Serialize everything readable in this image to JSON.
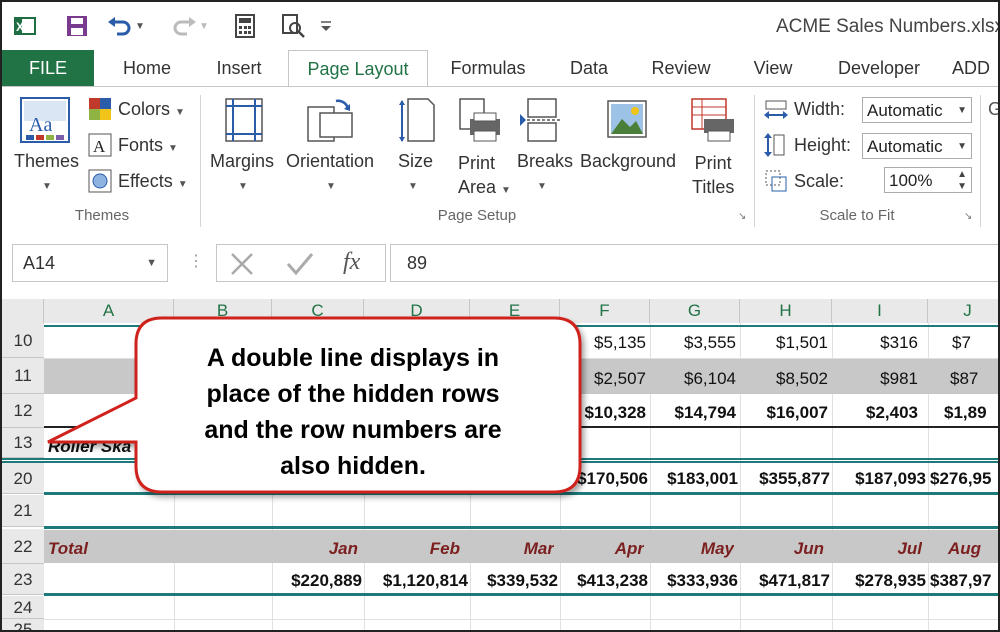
{
  "window": {
    "title": "ACME Sales Numbers.xlsx"
  },
  "qat": {
    "icons": [
      "excel-logo-icon",
      "save-icon",
      "undo-icon",
      "redo-icon",
      "calculator-icon",
      "print-preview-icon",
      "customize-icon"
    ]
  },
  "tabs": [
    "FILE",
    "Home",
    "Insert",
    "Page Layout",
    "Formulas",
    "Data",
    "Review",
    "View",
    "Developer",
    "ADD"
  ],
  "ribbon": {
    "themes_group": {
      "themes": "Themes",
      "colors": "Colors",
      "fonts": "Fonts",
      "effects": "Effects",
      "label": "Themes"
    },
    "page_setup": {
      "margins": "Margins",
      "orientation": "Orientation",
      "size": "Size",
      "print_area_1": "Print",
      "print_area_2": "Area",
      "breaks": "Breaks",
      "background": "Background",
      "print_titles_1": "Print",
      "print_titles_2": "Titles",
      "label": "Page Setup"
    },
    "scale_to_fit": {
      "width_label": "Width:",
      "width_value": "Automatic",
      "height_label": "Height:",
      "height_value": "Automatic",
      "scale_label": "Scale:",
      "scale_value": "100%",
      "label": "Scale to Fit"
    },
    "partial": "G"
  },
  "formula_bar": {
    "name_box": "A14",
    "value": "89",
    "fx": "fx"
  },
  "columns": [
    "A",
    "B",
    "C",
    "D",
    "E",
    "F",
    "G",
    "H",
    "I",
    "J"
  ],
  "rows": [
    {
      "num": "10",
      "cells": {
        "A": "",
        "F": "$5,135",
        "G": "$3,555",
        "H": "$1,501",
        "I": "$316",
        "J": "$7"
      }
    },
    {
      "num": "11",
      "cells": {
        "A": "$",
        "F": "$2,507",
        "G": "$6,104",
        "H": "$8,502",
        "I": "$981",
        "J": "$87"
      }
    },
    {
      "num": "12",
      "cells": {
        "F": "$10,328",
        "G": "$14,794",
        "H": "$16,007",
        "I": "$2,403",
        "J": "$1,89"
      }
    },
    {
      "num": "13",
      "cells": {
        "A": "Roller Ska"
      }
    },
    {
      "num": "20",
      "cells": {
        "F": "$170,506",
        "G": "$183,001",
        "H": "$355,877",
        "I": "$187,093",
        "J": "$276,95"
      }
    },
    {
      "num": "21",
      "cells": {}
    },
    {
      "num": "22",
      "cells": {
        "A": "Total",
        "C": "Jan",
        "D": "Feb",
        "E": "Mar",
        "F": "Apr",
        "G": "May",
        "H": "Jun",
        "I": "Jul",
        "J": "Aug"
      }
    },
    {
      "num": "23",
      "cells": {
        "C": "$220,889",
        "D": "$1,120,814",
        "E": "$339,532",
        "F": "$413,238",
        "G": "$333,936",
        "H": "$471,817",
        "I": "$278,935",
        "J": "$387,97"
      }
    },
    {
      "num": "24",
      "cells": {}
    },
    {
      "num": "25",
      "cells": {}
    }
  ],
  "callout": {
    "line1": "A double line displays in",
    "line2": "place of the hidden rows",
    "line3": "and the row numbers are",
    "line4": "also hidden."
  },
  "colors": {
    "excel_green": "#217346",
    "callout_border": "#d0201e",
    "teal_rule": "#1e7a7a",
    "banded_gray": "#c8c8c8",
    "month_red": "#7b1f1f"
  }
}
